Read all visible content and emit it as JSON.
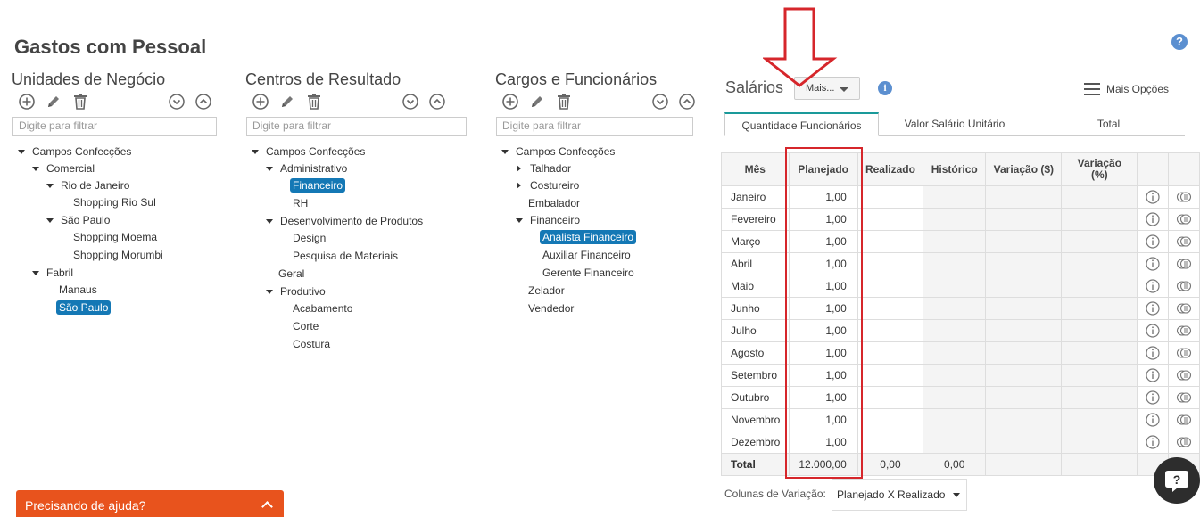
{
  "page": {
    "title": "Gastos com Pessoal",
    "help_icon": "question-circle-icon"
  },
  "colors": {
    "accent": "#1478b5",
    "help_bar": "#e8531d",
    "highlight_box": "#d6262b",
    "tab_active": "#1a9a9a"
  },
  "panels": {
    "unidades": {
      "title": "Unidades de Negócio",
      "filter_placeholder": "Digite para filtrar",
      "toolbar_icons": [
        "add-circle-icon",
        "pencil-icon",
        "trash-icon",
        "collapse-all-icon",
        "expand-all-icon"
      ],
      "tree": [
        {
          "label": "Campos Confecções",
          "arrow": "down"
        },
        {
          "label": "Comercial",
          "arrow": "down"
        },
        {
          "label": "Rio de Janeiro",
          "arrow": "down"
        },
        {
          "label": "Shopping Rio Sul"
        },
        {
          "label": "São Paulo",
          "arrow": "down"
        },
        {
          "label": "Shopping Moema"
        },
        {
          "label": "Shopping Morumbi"
        },
        {
          "label": "Fabril",
          "arrow": "down"
        },
        {
          "label": "Manaus"
        },
        {
          "label": "São Paulo",
          "selected": true
        }
      ]
    },
    "centros": {
      "title": "Centros de Resultado",
      "filter_placeholder": "Digite para filtrar",
      "tree": [
        {
          "label": "Campos Confecções",
          "arrow": "down"
        },
        {
          "label": "Administrativo",
          "arrow": "down"
        },
        {
          "label": "Financeiro",
          "selected": true
        },
        {
          "label": "RH"
        },
        {
          "label": "Desenvolvimento de Produtos",
          "arrow": "down"
        },
        {
          "label": "Design"
        },
        {
          "label": "Pesquisa de Materiais"
        },
        {
          "label": "Geral"
        },
        {
          "label": "Produtivo",
          "arrow": "down"
        },
        {
          "label": "Acabamento"
        },
        {
          "label": "Corte"
        },
        {
          "label": "Costura"
        }
      ]
    },
    "cargos": {
      "title": "Cargos e Funcionários",
      "filter_placeholder": "Digite para filtrar",
      "tree": [
        {
          "label": "Campos Confecções",
          "arrow": "down"
        },
        {
          "label": "Talhador",
          "arrow": "right"
        },
        {
          "label": "Costureiro",
          "arrow": "right"
        },
        {
          "label": "Embalador"
        },
        {
          "label": "Financeiro",
          "arrow": "down"
        },
        {
          "label": "Analista Financeiro",
          "selected": true
        },
        {
          "label": "Auxiliar Financeiro"
        },
        {
          "label": "Gerente Financeiro"
        },
        {
          "label": "Zelador"
        },
        {
          "label": "Vendedor"
        }
      ]
    }
  },
  "salarios": {
    "title": "Salários",
    "mais_button": "Mais...",
    "info_icon": "info-circle-icon",
    "mais_opcoes": "Mais Opções",
    "tabs": [
      "Quantidade Funcionários",
      "Valor Salário Unitário",
      "Total"
    ],
    "active_tab": 0,
    "columns": [
      "Mês",
      "Planejado",
      "Realizado",
      "Histórico",
      "Variação ($)",
      "Variação (%)"
    ],
    "rows": [
      {
        "mes": "Janeiro",
        "planejado": "1,00"
      },
      {
        "mes": "Fevereiro",
        "planejado": "1,00"
      },
      {
        "mes": "Março",
        "planejado": "1,00"
      },
      {
        "mes": "Abril",
        "planejado": "1,00"
      },
      {
        "mes": "Maio",
        "planejado": "1,00"
      },
      {
        "mes": "Junho",
        "planejado": "1,00"
      },
      {
        "mes": "Julho",
        "planejado": "1,00"
      },
      {
        "mes": "Agosto",
        "planejado": "1,00"
      },
      {
        "mes": "Setembro",
        "planejado": "1,00"
      },
      {
        "mes": "Outubro",
        "planejado": "1,00"
      },
      {
        "mes": "Novembro",
        "planejado": "1,00"
      },
      {
        "mes": "Dezembro",
        "planejado": "1,00"
      }
    ],
    "total": {
      "label": "Total",
      "planejado": "12.000,00",
      "realizado": "0,00",
      "historico": "0,00"
    },
    "row_icons": [
      "info-circle-icon",
      "money-icon"
    ],
    "variacao_label": "Colunas de Variação:",
    "variacao_value": "Planejado X Realizado"
  },
  "help_bar": {
    "label": "Precisando de ajuda?"
  },
  "chat": {
    "icon": "chat-question-icon"
  }
}
